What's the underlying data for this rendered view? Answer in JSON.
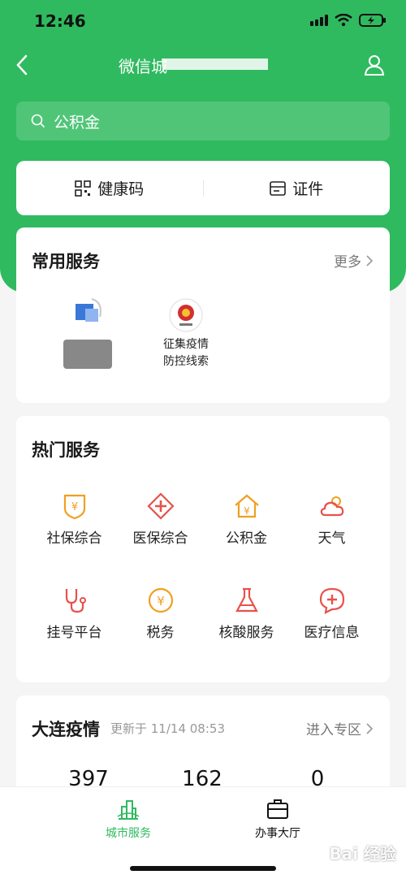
{
  "status": {
    "time": "12:46"
  },
  "nav": {
    "title": "微信城"
  },
  "search": {
    "placeholder": "公积金"
  },
  "quick": [
    {
      "label": "健康码",
      "icon": "qr-code-icon"
    },
    {
      "label": "证件",
      "icon": "id-card-icon"
    }
  ],
  "common": {
    "title": "常用服务",
    "more": "更多",
    "items": [
      {
        "label_line1": "",
        "label_line2": ""
      },
      {
        "label_line1": "征集疫情",
        "label_line2": "防控线索"
      }
    ]
  },
  "hot": {
    "title": "热门服务",
    "items": [
      {
        "label": "社保综合",
        "icon": "shield-yen-icon"
      },
      {
        "label": "医保综合",
        "icon": "medical-cross-icon"
      },
      {
        "label": "公积金",
        "icon": "house-yen-icon"
      },
      {
        "label": "天气",
        "icon": "weather-icon"
      },
      {
        "label": "挂号平台",
        "icon": "stethoscope-icon"
      },
      {
        "label": "税务",
        "icon": "yen-coin-icon"
      },
      {
        "label": "核酸服务",
        "icon": "flask-icon"
      },
      {
        "label": "医疗信息",
        "icon": "chat-cross-icon"
      }
    ]
  },
  "epidemic": {
    "title": "大连疫情",
    "updated": "更新于 11/14 08:53",
    "enter": "进入专区",
    "stats": [
      "397",
      "162",
      "0"
    ]
  },
  "tabs": [
    {
      "label": "城市服务",
      "active": true
    },
    {
      "label": "办事大厅",
      "active": false
    }
  ],
  "watermark": "Bai 经验",
  "colors": {
    "brand": "#2fba5f",
    "icon_orange": "#f0a020",
    "icon_red": "#e8514a"
  }
}
